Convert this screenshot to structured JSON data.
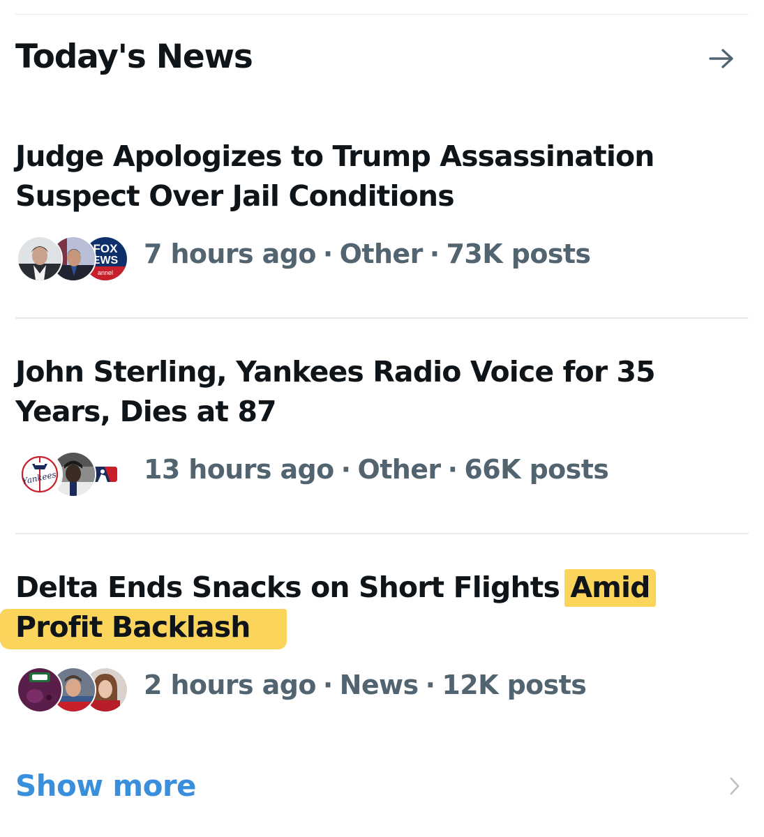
{
  "header": {
    "title": "Today's News",
    "arrow_icon": "arrow-right-icon"
  },
  "items": [
    {
      "headline": "Judge Apologizes to Trump Assassination Suspect Over Jail Conditions",
      "time": "7 hours ago",
      "category": "Other",
      "posts": "73K posts",
      "avatar_badge": "FOX EWS"
    },
    {
      "headline": "John Sterling, Yankees Radio Voice for 35 Years, Dies at 87",
      "time": "13 hours ago",
      "category": "Other",
      "posts": "66K posts",
      "avatar_badge": "Yankees"
    },
    {
      "headline_plain": "Delta Ends Snacks on Short Flights",
      "headline_highlight_1": "Amid",
      "headline_highlight_2": "Profit Backlash",
      "time": "2 hours ago",
      "category": "News",
      "posts": "12K posts"
    }
  ],
  "separator": "·",
  "footer": {
    "show_more": "Show more",
    "chevron_icon": "chevron-right-icon"
  },
  "colors": {
    "text_primary": "#0f1419",
    "text_secondary": "#536471",
    "link": "#3a8fdc",
    "highlight": "#fbd55b",
    "divider": "#e7e9eb"
  }
}
